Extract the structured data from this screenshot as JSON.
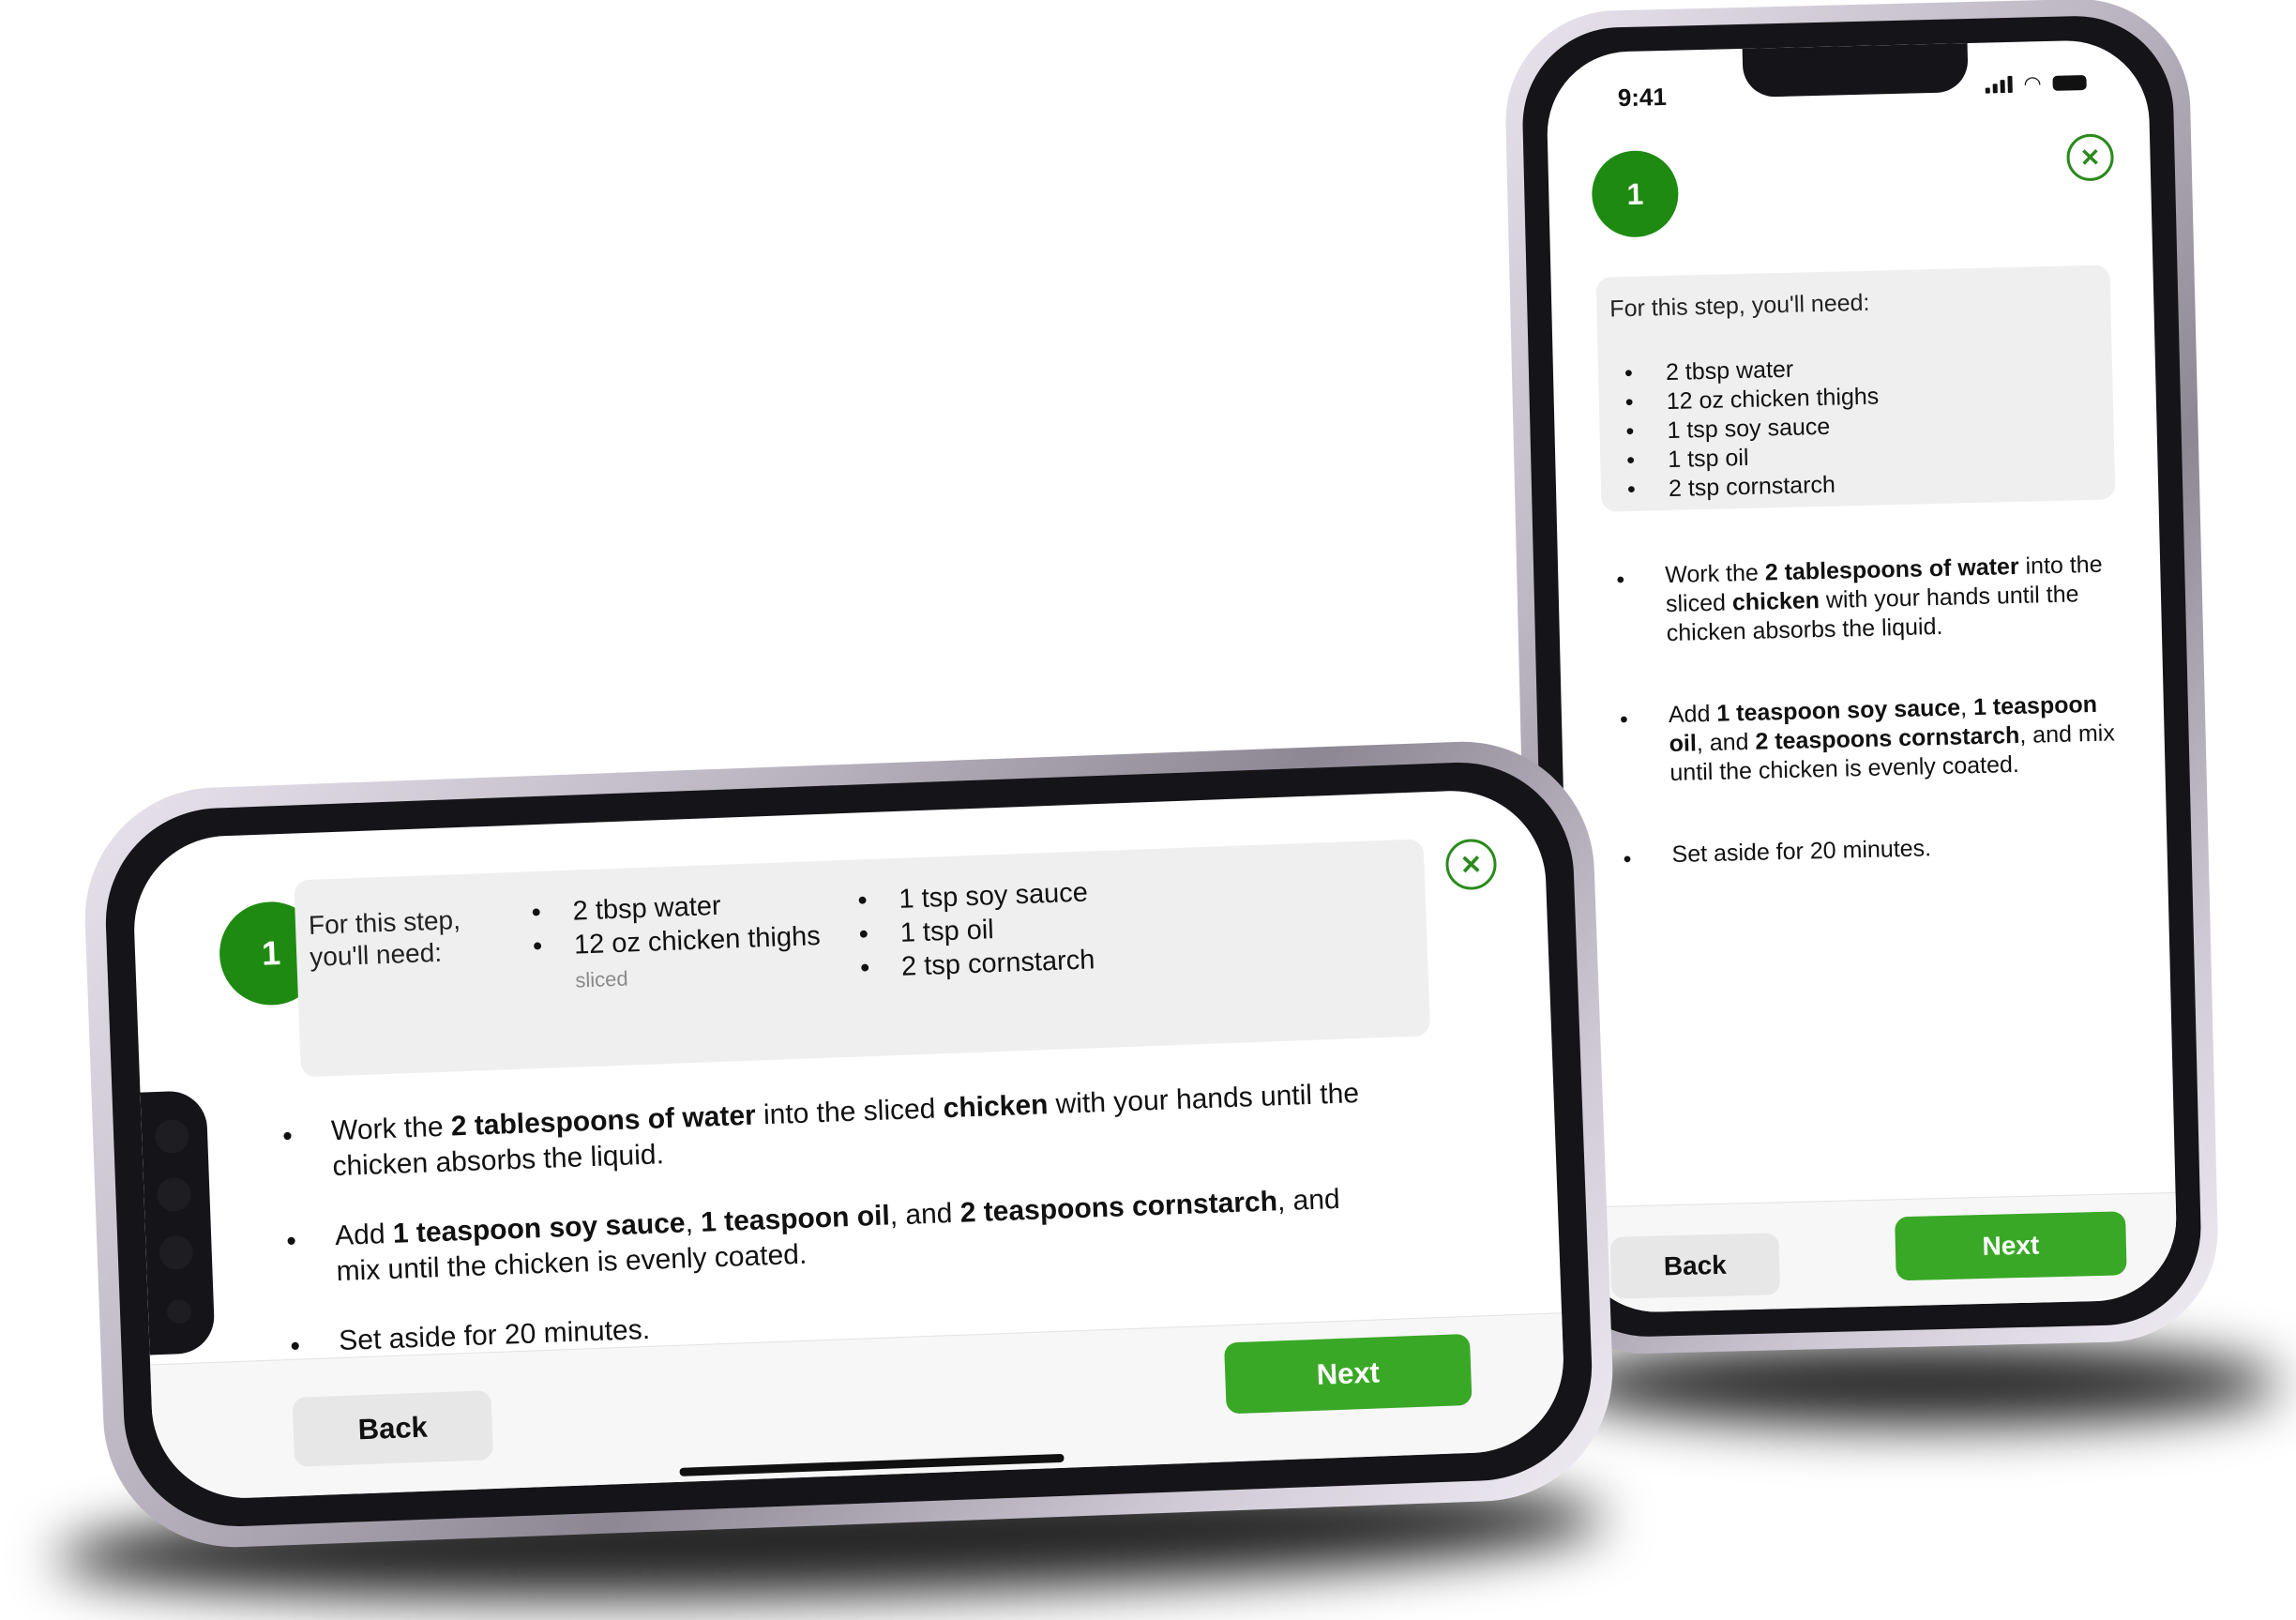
{
  "colors": {
    "accent": "#1e8a12",
    "next_button": "#39a826",
    "panel": "#efefef"
  },
  "landscape": {
    "step_number": "1",
    "need_label": "For this step, you'll need:",
    "ingredients_col1": [
      {
        "text": "2 tbsp water",
        "note": ""
      },
      {
        "text": "12 oz chicken thighs",
        "note": "sliced"
      }
    ],
    "ingredients_col2": [
      {
        "text": "1 tsp soy sauce"
      },
      {
        "text": "1 tsp oil"
      },
      {
        "text": "2 tsp cornstarch"
      }
    ],
    "close_icon": "close-icon",
    "back_label": "Back",
    "next_label": "Next"
  },
  "portrait": {
    "status_time": "9:41",
    "step_number": "1",
    "need_label": "For this step, you'll need:",
    "ingredients": [
      "2 tbsp water",
      "12 oz chicken thighs",
      "1 tsp soy sauce",
      "1 tsp oil",
      "2 tsp cornstarch"
    ],
    "close_icon": "close-icon",
    "back_label": "Back",
    "next_label": "Next"
  },
  "instructions": [
    {
      "p1": "Work the ",
      "b1": "2 tablespoons of water",
      "p2": " into the sliced ",
      "b2": "chicken",
      "p3": " with your hands until the chicken absorbs the liquid."
    },
    {
      "p1": "Add ",
      "b1": "1 teaspoon soy sauce",
      "p2": ", ",
      "b2": "1 teaspoon oil",
      "p3": ", and ",
      "b3": "2 teaspoons cornstarch",
      "p4": ", and mix until the chicken is evenly coated."
    },
    {
      "p1": "Set aside for 20 minutes."
    }
  ]
}
